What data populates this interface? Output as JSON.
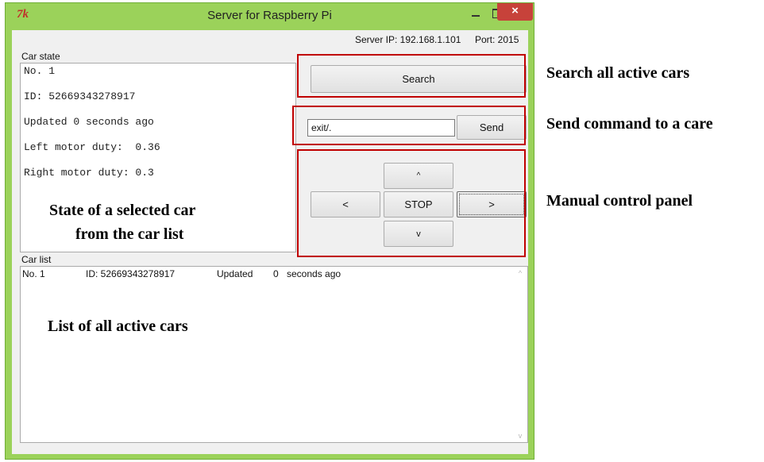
{
  "window": {
    "title": "Server for Raspberry Pi",
    "icon_text": "7k",
    "close_glyph": "×"
  },
  "server": {
    "ip_text": "Server IP: 192.168.1.101",
    "port_text": "Port: 2015"
  },
  "car_state": {
    "label": "Car state",
    "lines": [
      "No. 1",
      "ID: 52669343278917",
      "Updated 0 seconds ago",
      "Left motor duty:  0.36",
      "Right motor duty: 0.3"
    ]
  },
  "car_list": {
    "label": "Car list",
    "rows": [
      {
        "no": "No. 1",
        "id": "ID: 52669343278917",
        "updated": "Updated",
        "seconds": "0",
        "ago": "seconds ago"
      }
    ],
    "scroll_up": "^",
    "scroll_down": "v"
  },
  "controls": {
    "search_label": "Search",
    "command_value": "exit/.",
    "send_label": "Send",
    "up_label": "^",
    "left_label": "<",
    "stop_label": "STOP",
    "right_label": ">",
    "down_label": "v"
  },
  "annotations": {
    "search": "Search all active cars",
    "send": "Send command to a care",
    "manual": "Manual control panel",
    "state_line1": "State of a selected car",
    "state_line2": "from the car list",
    "list": "List of all active cars"
  },
  "colors": {
    "window_frame": "#9bd25a",
    "close_button": "#c7423a",
    "annotation_box": "#c00000"
  }
}
